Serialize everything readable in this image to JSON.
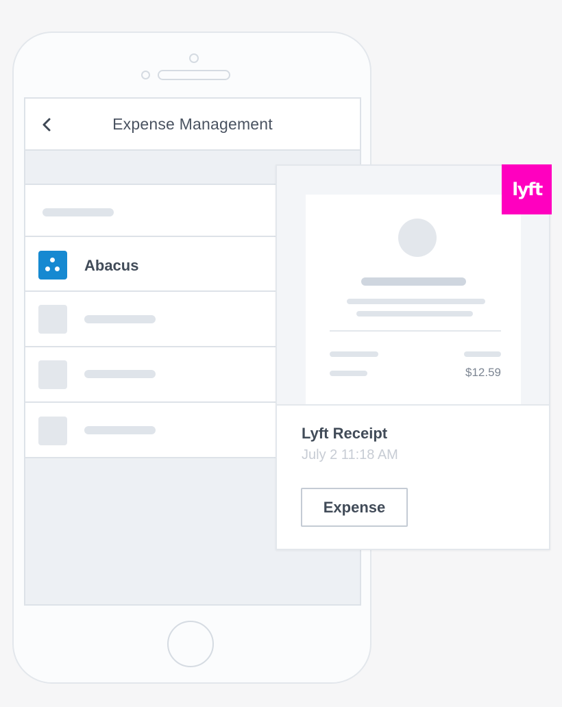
{
  "nav": {
    "title": "Expense Management",
    "back_icon": "chevron-left-icon"
  },
  "list": {
    "selected_item": {
      "label": "Abacus",
      "icon": "abacus-logo-icon",
      "icon_color": "#1689d1"
    }
  },
  "receipt": {
    "brand_logo": "lyft-logo",
    "brand_text": "lyft",
    "brand_color": "#ff00bf",
    "amount": "$12.59",
    "title": "Lyft Receipt",
    "date": "July 2 11:18 AM",
    "action_label": "Expense"
  },
  "colors": {
    "background": "#f6f6f7",
    "text_primary": "#414b58",
    "text_muted": "#c7ccd4",
    "placeholder": "#dfe4ea"
  }
}
